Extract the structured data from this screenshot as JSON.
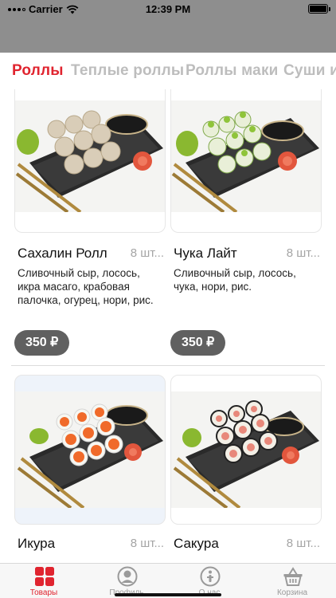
{
  "status_bar": {
    "carrier": "Carrier",
    "time": "12:39 PM"
  },
  "categories": [
    {
      "label": "Роллы",
      "active": true
    },
    {
      "label": "Теплые роллы",
      "active": false
    },
    {
      "label": "Роллы маки",
      "active": false
    },
    {
      "label": "Суши и",
      "active": false
    }
  ],
  "products": [
    {
      "name": "Сахалин Ролл",
      "qty": "8 шт...",
      "description": "Сливочный сыр, лосось, икра масаго, крабовая палочка, огурец, нори, рис.",
      "price": "350 ₽",
      "photo": "sushi-roll-photo"
    },
    {
      "name": "Чука Лайт",
      "qty": "8 шт...",
      "description": "Сливочный сыр, лосось, чука, нори, рис.",
      "price": "350 ₽",
      "photo": "sushi-roll-photo"
    },
    {
      "name": "Икура",
      "qty": "8 шт...",
      "photo": "sushi-roll-photo"
    },
    {
      "name": "Сакура",
      "qty": "8 шт...",
      "photo": "sushi-roll-photo"
    }
  ],
  "tab_bar": {
    "items": [
      {
        "label": "Товары",
        "icon": "grid-icon",
        "active": true
      },
      {
        "label": "Профиль",
        "icon": "profile-icon",
        "active": false
      },
      {
        "label": "О нас",
        "icon": "info-icon",
        "active": false
      },
      {
        "label": "Корзина",
        "icon": "basket-icon",
        "active": false
      }
    ]
  },
  "colors": {
    "accent": "#e0242f",
    "price_pill": "#606060",
    "header": "#8e8e8e"
  }
}
